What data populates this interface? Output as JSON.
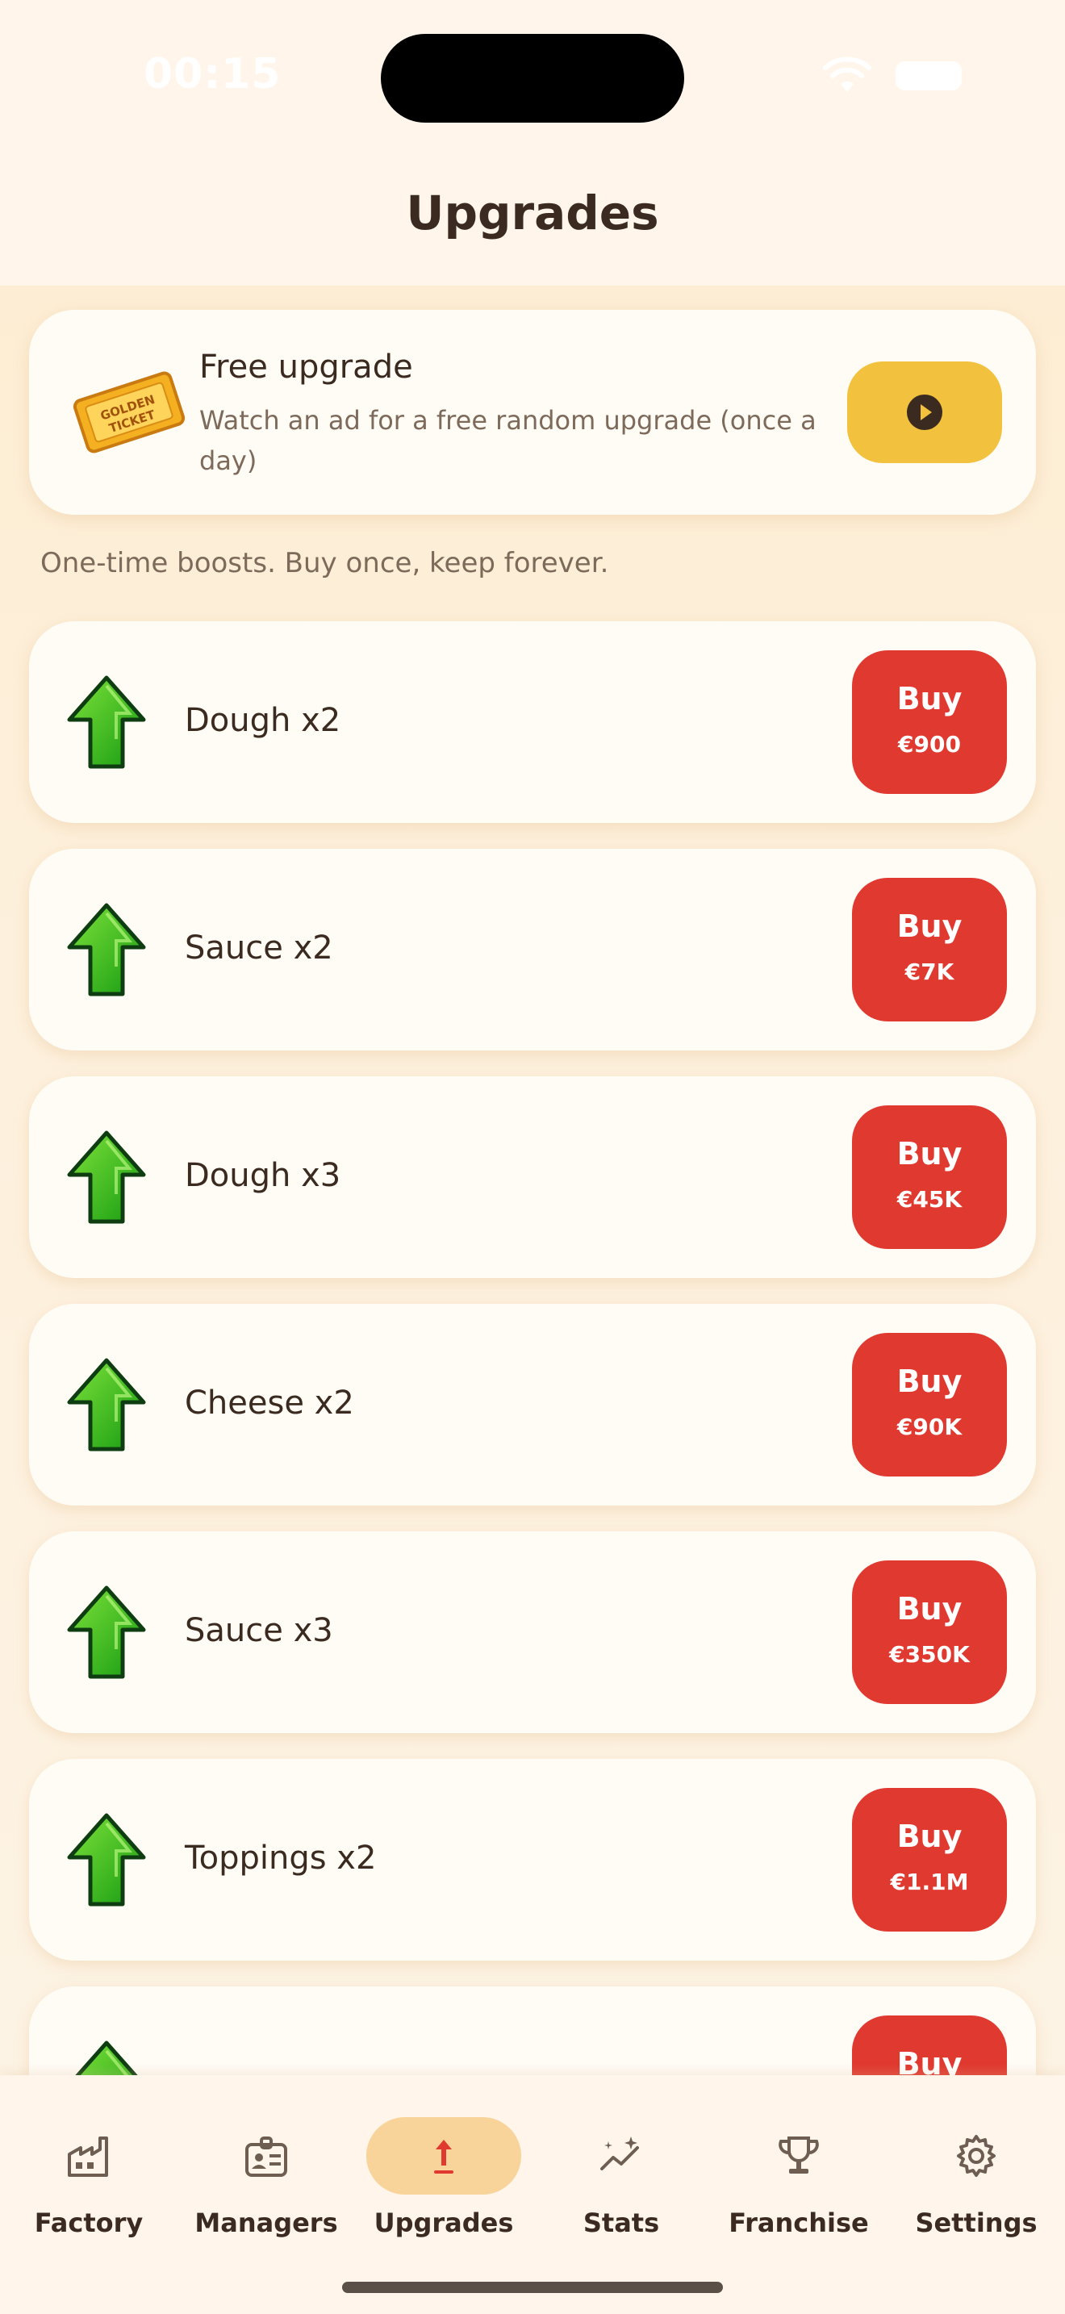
{
  "status_bar": {
    "time": "00:15"
  },
  "header": {
    "title": "Upgrades"
  },
  "promo": {
    "title": "Free upgrade",
    "description": "Watch an ad for a free random upgrade (once a day)",
    "ticket_text": "GOLDEN TICKET",
    "button_icon": "play-icon"
  },
  "subtitle": "One-time boosts. Buy once, keep forever.",
  "upgrades": [
    {
      "name": "Dough x2",
      "buy_label": "Buy",
      "price": "€900"
    },
    {
      "name": "Sauce x2",
      "buy_label": "Buy",
      "price": "€7K"
    },
    {
      "name": "Dough x3",
      "buy_label": "Buy",
      "price": "€45K"
    },
    {
      "name": "Cheese x2",
      "buy_label": "Buy",
      "price": "€90K"
    },
    {
      "name": "Sauce x3",
      "buy_label": "Buy",
      "price": "€350K"
    },
    {
      "name": "Toppings x2",
      "buy_label": "Buy",
      "price": "€1.1M"
    },
    {
      "name": "",
      "buy_label": "Buy",
      "price": ""
    }
  ],
  "tabs": [
    {
      "label": "Factory",
      "icon": "factory-icon",
      "active": false
    },
    {
      "label": "Managers",
      "icon": "id-badge-icon",
      "active": false
    },
    {
      "label": "Upgrades",
      "icon": "upgrade-arrow-icon",
      "active": true
    },
    {
      "label": "Stats",
      "icon": "stats-sparkle-icon",
      "active": false
    },
    {
      "label": "Franchise",
      "icon": "trophy-icon",
      "active": false
    },
    {
      "label": "Settings",
      "icon": "gear-icon",
      "active": false
    }
  ],
  "colors": {
    "accent_buy": "#e0392f",
    "accent_watch": "#f2c13d",
    "active_tab": "#f8d49a",
    "text_dark": "#3b2a1f",
    "text_muted": "#7d6a5a",
    "arrow_green": "#2fb51f"
  }
}
